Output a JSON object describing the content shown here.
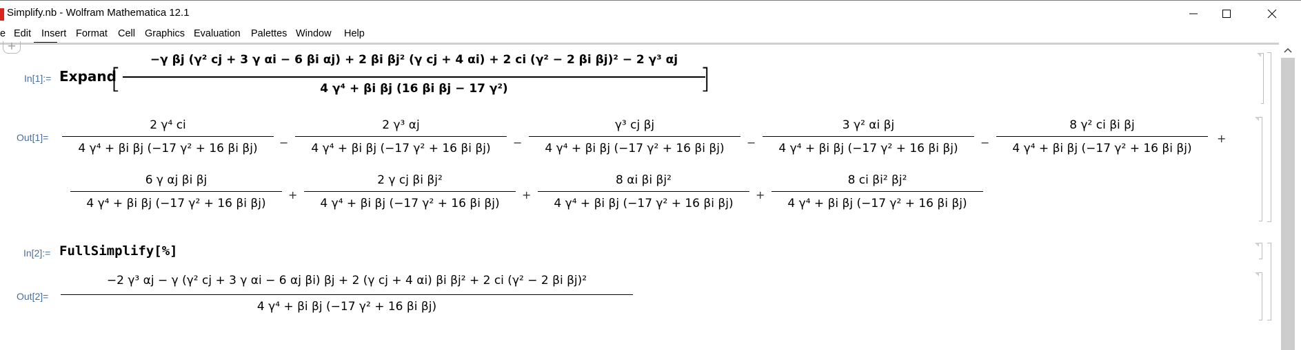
{
  "window": {
    "title": "Simplify.nb - Wolfram Mathematica 12.1",
    "controls": {
      "minimize": "minimize",
      "maximize": "maximize",
      "close": "close"
    }
  },
  "menu": [
    "e",
    "Edit",
    "Insert",
    "Format",
    "Cell",
    "Graphics",
    "Evaluation",
    "Palettes",
    "Window",
    "Help"
  ],
  "cells": {
    "in1": {
      "label": "In[1]:=",
      "function": "Expand",
      "numerator": "−γ βj (γ² cj + 3 γ αi − 6 βi αj) + 2 βi βj² (γ cj + 4 αi) + 2 ci (γ² − 2 βi βj)² − 2 γ³ αj",
      "denominator": "4 γ⁴ + βi βj (16 βi βj − 17 γ²)"
    },
    "out1": {
      "label": "Out[1]=",
      "common_denominator": "4 γ⁴ + βi βj (−17 γ² + 16 βi βj)",
      "terms": [
        {
          "sign": "",
          "numerator": "2 γ⁴ ci"
        },
        {
          "sign": "−",
          "numerator": "2 γ³ αj"
        },
        {
          "sign": "−",
          "numerator": "γ³ cj βj"
        },
        {
          "sign": "−",
          "numerator": "3 γ² αi βj"
        },
        {
          "sign": "−",
          "numerator": "8 γ² ci βi βj"
        },
        {
          "sign": "+",
          "numerator": "6 γ αj βi βj"
        },
        {
          "sign": "+",
          "numerator": "2 γ cj βi βj²"
        },
        {
          "sign": "+",
          "numerator": "8 αi βi βj²"
        },
        {
          "sign": "+",
          "numerator": "8 ci βi² βj²"
        }
      ]
    },
    "in2": {
      "label": "In[2]:=",
      "expression": "FullSimplify[%]"
    },
    "out2": {
      "label": "Out[2]=",
      "numerator": "−2 γ³ αj − γ (γ² cj + 3 γ αi − 6 αj βi) βj + 2 (γ cj + 4 αi) βi βj² + 2 ci (γ² − 2 βi βj)²",
      "denominator": "4 γ⁴ + βi βj (−17 γ² + 16 βi βj)"
    }
  }
}
